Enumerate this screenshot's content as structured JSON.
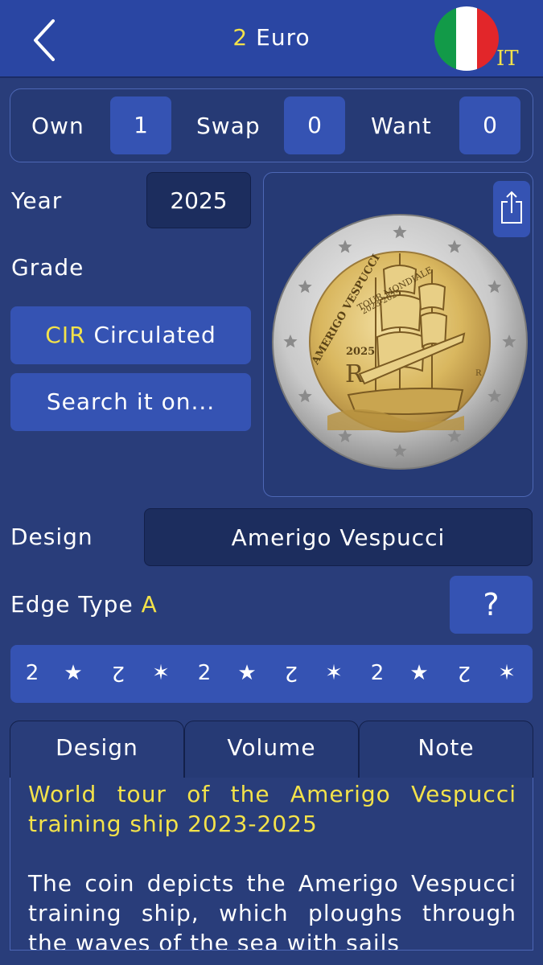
{
  "header": {
    "title_value": "2",
    "title_unit": "Euro",
    "country_code": "IT",
    "flag_colors": [
      "#129a48",
      "#ffffff",
      "#e2262a"
    ],
    "accent_color": "#f3e24a"
  },
  "counters": {
    "own_label": "Own",
    "own_value": "1",
    "swap_label": "Swap",
    "swap_value": "0",
    "want_label": "Want",
    "want_value": "0"
  },
  "year": {
    "label": "Year",
    "value": "2025"
  },
  "grade": {
    "label": "Grade",
    "code": "CIR",
    "name": "Circulated"
  },
  "search_button": "Search it on...",
  "coin_image": {
    "inscription_top": "AMERIGO VESPUCCI",
    "inscription_mid": "TOUR MONDIALE",
    "inscription_years": "2023-2025",
    "year": "2025",
    "mint_mark": "R",
    "monogram": "R",
    "icon": "ship-coin-icon"
  },
  "design": {
    "label": "Design",
    "value": "Amerigo Vespucci"
  },
  "edge": {
    "label": "Edge Type",
    "type": "A",
    "help_label": "?",
    "pattern": [
      "2",
      "★",
      "2",
      "✶",
      "2",
      "★",
      "2",
      "✶",
      "2",
      "★",
      "2",
      "✶"
    ],
    "flipped": [
      false,
      false,
      true,
      false,
      false,
      false,
      true,
      false,
      false,
      false,
      true,
      false
    ]
  },
  "tabs": [
    {
      "label": "Design"
    },
    {
      "label": "Volume"
    },
    {
      "label": "Note"
    }
  ],
  "description": {
    "title": "World tour of the Amerigo Vespucci training ship 2023-2025",
    "body": "The coin depicts the Amerigo Vespucci training ship, which ploughs through the waves of the sea with sails"
  }
}
